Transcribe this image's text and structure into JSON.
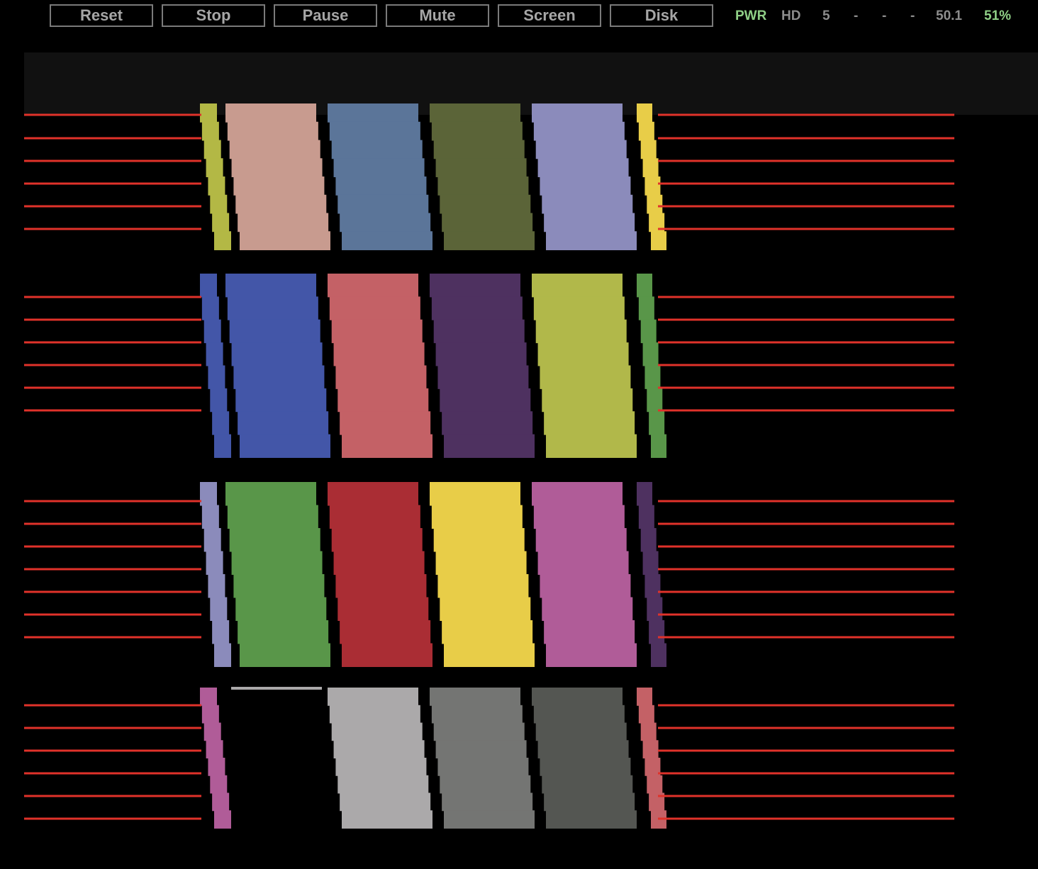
{
  "toolbar": {
    "reset_label": "Reset",
    "stop_label": "Stop",
    "pause_label": "Pause",
    "mute_label": "Mute",
    "screen_label": "Screen",
    "disk_label": "Disk"
  },
  "status": {
    "pwr": "PWR",
    "hd": "HD",
    "slot1": "5",
    "slot2": "-",
    "slot3": "-",
    "slot4": "-",
    "fps": "50.1",
    "percent": "51%"
  },
  "colors": {
    "background": "#000000",
    "screen_band": "#111111",
    "raster_line": "#e0322a",
    "button_border": "#7a7a7a",
    "button_text": "#a6a6a6",
    "status_active": "#8fcf86",
    "status_idle": "#8c8c8c"
  },
  "palette_rows": [
    [
      "#b3b845",
      "#c89b8f",
      "#5b7599",
      "#5b6438",
      "#8b8bbb",
      "#e8cd48"
    ],
    [
      "#4356a8",
      "#4356a8",
      "#c46166",
      "#4e3160",
      "#b1b84a",
      "#599649"
    ],
    [
      "#8b8bbb",
      "#599649",
      "#aa2d34",
      "#e8cd48",
      "#b05c98",
      "#4e3160"
    ],
    [
      "#b05c98",
      "#000000",
      "#aba9aa",
      "#747573",
      "#545652",
      "#c46166"
    ]
  ]
}
